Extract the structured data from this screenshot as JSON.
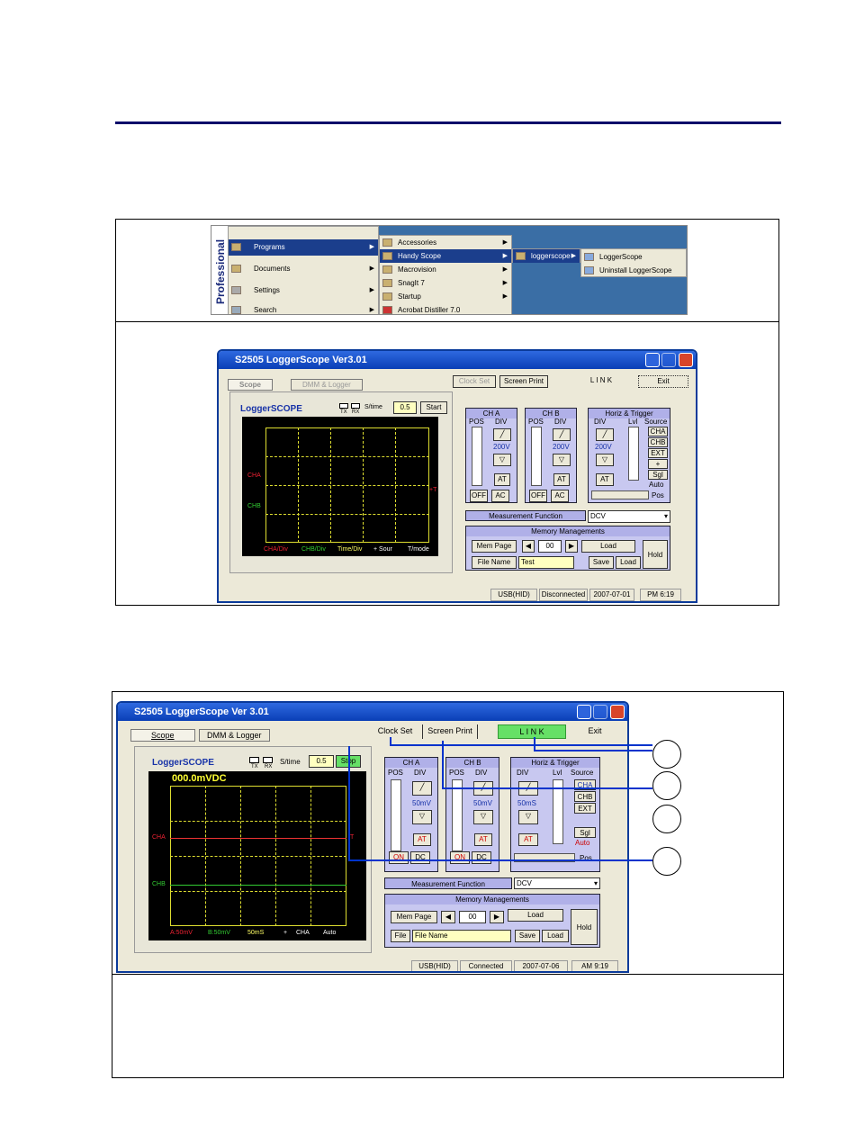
{
  "start_menu": {
    "side_label": "Professional",
    "main_items": [
      "Programs",
      "Documents",
      "Settings",
      "Search"
    ],
    "programs_items": [
      "Accessories",
      "Handy Scope",
      "Macrovision",
      "SnagIt 7",
      "Startup",
      "Acrobat Distiller 7.0"
    ],
    "handy_items": [
      "loggerscope"
    ],
    "logger_items": [
      "LoggerScope",
      "Uninstall LoggerScope"
    ]
  },
  "win1": {
    "title": "S2505 LoggerScope Ver3.01",
    "tabs": [
      "Scope",
      "DMM & Logger"
    ],
    "clock_set": "Clock Set",
    "screen_print": "Screen Print",
    "link": "L I N K",
    "exit": "Exit",
    "logo": "LoggerSCOPE",
    "tx": "TX",
    "rx": "RX",
    "stime_label": "S/time",
    "stime_value": "0.5",
    "start": "Start",
    "cha_label": "CHA",
    "chb_label": "CHB",
    "t_marker": "+T",
    "footer": [
      "CHA/Div",
      "CHB/Div",
      "Time/Div",
      "+ Sour",
      "T/mode"
    ],
    "cha": {
      "title": "CH A",
      "pos": "POS",
      "div": "DIV",
      "value": "200V",
      "at": "AT",
      "off": "OFF",
      "ac": "AC"
    },
    "chb": {
      "title": "CH B",
      "pos": "POS",
      "div": "DIV",
      "value": "200V",
      "at": "AT",
      "off": "OFF",
      "ac": "AC"
    },
    "horiz": {
      "title": "Horiz & Trigger",
      "div": "DIV",
      "lvl": "Lvl",
      "source": "Source",
      "value": "200V",
      "at": "AT",
      "sources": [
        "CHA",
        "CHB",
        "EXT",
        "+",
        "Sgl",
        "Auto"
      ],
      "pos": "Pos"
    },
    "measurement_label": "Measurement Function",
    "measurement_value": "DCV",
    "memory_title": "Memory Managements",
    "mem_page": "Mem Page",
    "mem_value": "00",
    "load": "Load",
    "hold": "Hold",
    "file_name_label": "File Name",
    "file_name_value": "Test",
    "save": "Save",
    "load2": "Load",
    "status": [
      "USB(HID)",
      "Disconnected",
      "2007-07-01",
      "PM 6:19"
    ]
  },
  "win2": {
    "title": "S2505 LoggerScope Ver 3.01",
    "tabs": [
      "Scope",
      "DMM & Logger"
    ],
    "clock_set": "Clock Set",
    "screen_print": "Screen Print",
    "link": "L I N K",
    "exit": "Exit",
    "logo": "LoggerSCOPE",
    "tx": "TX",
    "rx": "RX",
    "stime_label": "S/time",
    "stime_value": "0.5",
    "stop": "Stop",
    "reading": "000.0mVDC",
    "cha_label": "CHA",
    "chb_label": "CHB",
    "t_marker": "T",
    "footer": [
      "A:50mV",
      "B:50mV",
      "50mS",
      "+",
      "CHA",
      "Auto"
    ],
    "cha": {
      "title": "CH A",
      "pos": "POS",
      "div": "DIV",
      "value": "50mV",
      "at": "AT",
      "on": "ON",
      "dc": "DC"
    },
    "chb": {
      "title": "CH B",
      "pos": "POS",
      "div": "DIV",
      "value": "50mV",
      "at": "AT",
      "on": "ON",
      "dc": "DC"
    },
    "horiz": {
      "title": "Horiz & Trigger",
      "div": "DIV",
      "lvl": "Lvl",
      "source": "Source",
      "value": "50mS",
      "at": "AT",
      "sources": [
        "CHA",
        "CHB",
        "EXT",
        "Sgl",
        "Auto"
      ],
      "pos": "Pos"
    },
    "measurement_label": "Measurement Function",
    "measurement_value": "DCV",
    "memory_title": "Memory Managements",
    "mem_page": "Mem Page",
    "mem_value": "00",
    "load": "Load",
    "hold": "Hold",
    "file_label": "File",
    "file_name_value": "File Name",
    "save": "Save",
    "load2": "Load",
    "status": [
      "USB(HID)",
      "Connected",
      "2007-07-06",
      "AM 9:19"
    ]
  },
  "colors": {
    "rule": "#0a0a6a",
    "link_active": "#66e066",
    "callout_line": "#0033cc"
  }
}
